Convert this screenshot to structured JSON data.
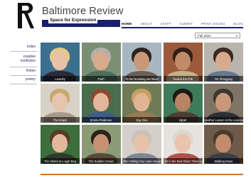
{
  "site": {
    "title": "Baltimore Review",
    "tagline": "Space for Expression",
    "logo_icon": "r-logo-icon"
  },
  "nav": {
    "items": [
      "HOME",
      "ABOUT",
      "STAFF",
      "SUBMIT",
      "PRINT ISSUES",
      "BLOG"
    ],
    "active": "HOME"
  },
  "issue_select": {
    "value": "Fall 2021"
  },
  "sidebar": {
    "items": [
      "index",
      "creative nonfiction",
      "fiction",
      "poetry"
    ]
  },
  "tiles": [
    {
      "caption": "Laundry",
      "bg": "#3d6f8f",
      "hair": "#e3c98a",
      "face": "#e8c2a6",
      "shoulders": "#2b2b3a"
    },
    {
      "caption": "Truth",
      "bg": "#7a8f74",
      "hair": "#b5b1aa",
      "face": "#d9a98c",
      "shoulders": "#4f6e5c"
    },
    {
      "caption": "To the Nosebag and Back",
      "bg": "#a8b6c2",
      "hair": "#2d2420",
      "face": "#c99877",
      "shoulders": "#6c5f58"
    },
    {
      "caption": "Toward the Pith",
      "bg": "#9b5a3c",
      "hair": "#2e2118",
      "face": "#c18a68",
      "shoulders": "#c7b08a"
    },
    {
      "caption": "On Shrugging",
      "bg": "#b8b4ae",
      "hair": "#3a2a22",
      "face": "#d7aa90",
      "shoulders": "#6a7a8b"
    },
    {
      "caption": "The Knack",
      "bg": "#d8d2c6",
      "hair": "#c9a86e",
      "face": "#e6c4ae",
      "shoulders": "#a89b8c"
    },
    {
      "caption": "Emma Pedersen",
      "bg": "#4a6d4e",
      "hair": "#8b4a2f",
      "face": "#e3b59a",
      "shoulders": "#3f5c8a"
    },
    {
      "caption": "Day One",
      "bg": "#6f7b56",
      "hair": "#c79f62",
      "face": "#e0b494",
      "shoulders": "#9a7a56"
    },
    {
      "caption": "Hijrah",
      "bg": "#3f7a5a",
      "hair": "#1e1814",
      "face": "#b78464",
      "shoulders": "#4f3c33"
    },
    {
      "caption": "Another Lesson in the Lexicon",
      "bg": "#7d7466",
      "hair": "#3a3630",
      "face": "#c9987b",
      "shoulders": "#2d2f35"
    },
    {
      "caption": "The Shield at Lough Beg",
      "bg": "#3d6e3c",
      "hair": "#5a3a26",
      "face": "#e2b79b",
      "shoulders": "#2f3a2d"
    },
    {
      "caption": "The Sudden Crows",
      "bg": "#8a9b76",
      "hair": "#2b211c",
      "face": "#c89272",
      "shoulders": "#5a4a3a"
    },
    {
      "caption": "After Selling Your Lake House",
      "bg": "#d4cfc8",
      "hair": "#c7c2bc",
      "face": "#e6c1a8",
      "shoulders": "#7f8694"
    },
    {
      "caption": "We Sit in the Red Glider These Late",
      "bg": "#e6e2de",
      "hair": "#dcd6cf",
      "face": "#e9c3ab",
      "shoulders": "#b5504a"
    },
    {
      "caption": "Walking Down",
      "bg": "#6d5a48",
      "hair": "#4a3a2e",
      "face": "#c18d6d",
      "shoulders": "#3a3e4a"
    }
  ]
}
